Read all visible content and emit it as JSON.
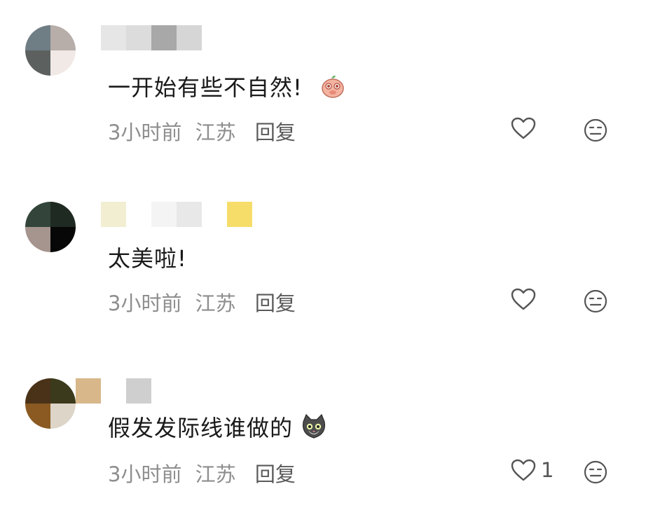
{
  "comments": [
    {
      "username": "",
      "text": "一开始有些不自然!",
      "emoji": "peach-face-emoji",
      "time": "3小时前",
      "location": "江苏",
      "reply_label": "回复",
      "like_count": "",
      "like_icon": "heart-icon",
      "dislike_icon": "neutral-face-icon"
    },
    {
      "username": "",
      "text": "太美啦!",
      "emoji": "",
      "time": "3小时前",
      "location": "江苏",
      "reply_label": "回复",
      "like_count": "",
      "like_icon": "heart-icon",
      "dislike_icon": "neutral-face-icon"
    },
    {
      "username": "",
      "text": "假发发际线谁做的",
      "emoji": "cat-face-emoji",
      "time": "3小时前",
      "location": "江苏",
      "reply_label": "回复",
      "like_count": "1",
      "like_icon": "heart-icon",
      "dislike_icon": "neutral-face-icon"
    }
  ],
  "colors": {
    "text": "#1a1a1a",
    "meta": "#8e8e8e",
    "reply": "#5a5a5a",
    "icon_stroke": "#555555"
  }
}
